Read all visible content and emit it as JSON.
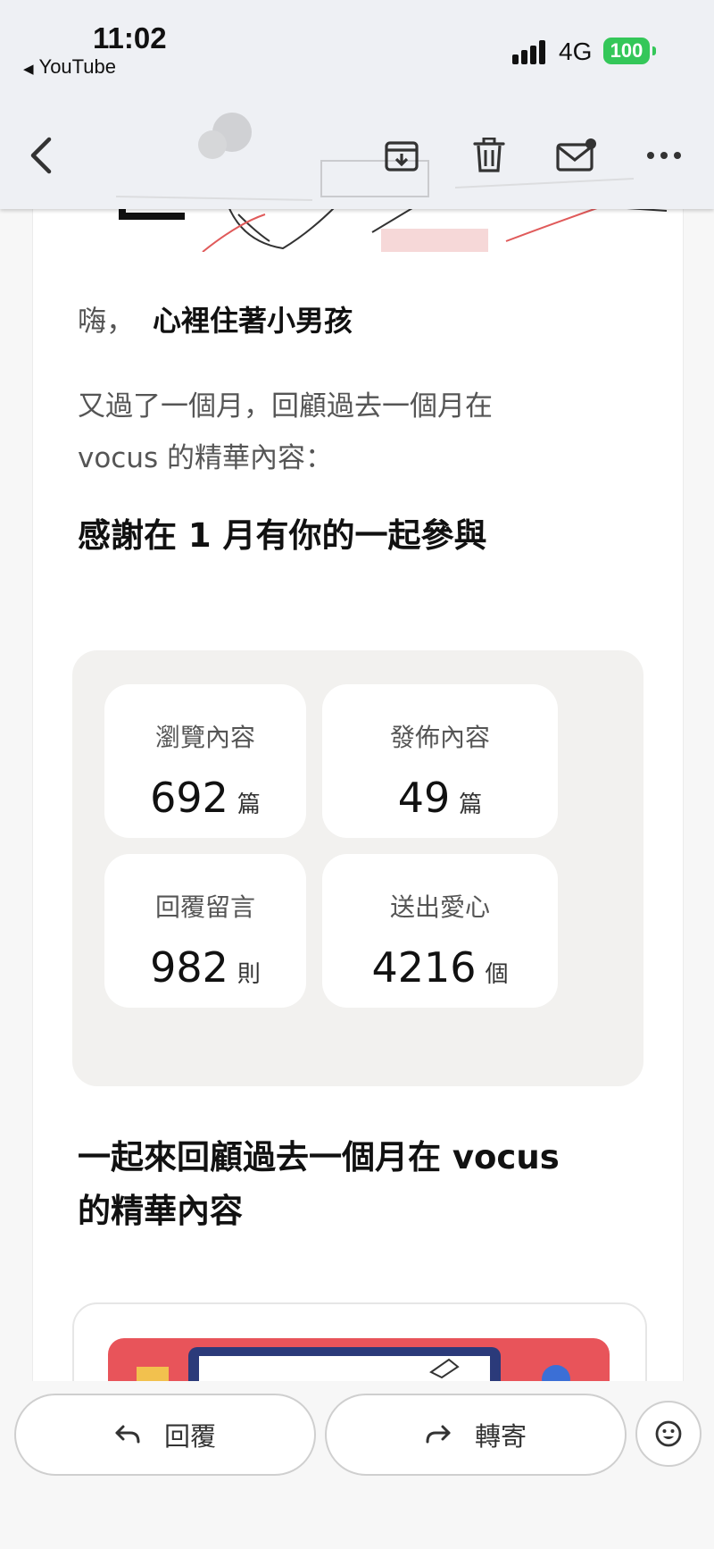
{
  "status_bar": {
    "time": "11:02",
    "back_app": "YouTube",
    "network": "4G",
    "battery": "100"
  },
  "toolbar": {
    "icons": [
      "chevron-left-icon",
      "archive-icon",
      "trash-icon",
      "mail-unread-icon",
      "more-icon"
    ]
  },
  "email": {
    "greeting_hi": "嗨，",
    "greeting_name": "心裡住著小男孩",
    "intro_line1": "又過了一個月，回顧過去一個月在",
    "intro_line2": "vocus 的精華內容：",
    "stats_title": "感謝在 1 月有你的一起參與",
    "stats": [
      {
        "label": "瀏覽內容",
        "value": "692",
        "unit": "篇"
      },
      {
        "label": "發佈內容",
        "value": "49",
        "unit": "篇"
      },
      {
        "label": "回覆留言",
        "value": "982",
        "unit": "則"
      },
      {
        "label": "送出愛心",
        "value": "4216",
        "unit": "個"
      }
    ],
    "review_title_line1": "一起來回顧過去一個月在 vocus",
    "review_title_line2": "的精華內容"
  },
  "bottom_bar": {
    "reply_label": "回覆",
    "forward_label": "轉寄"
  },
  "colors": {
    "battery": "#34c759",
    "toolbar_bg": "#eef0f4",
    "stats_bg": "#f2f1ef",
    "preview_red": "#e8545a",
    "preview_navy": "#2b3a7a"
  }
}
